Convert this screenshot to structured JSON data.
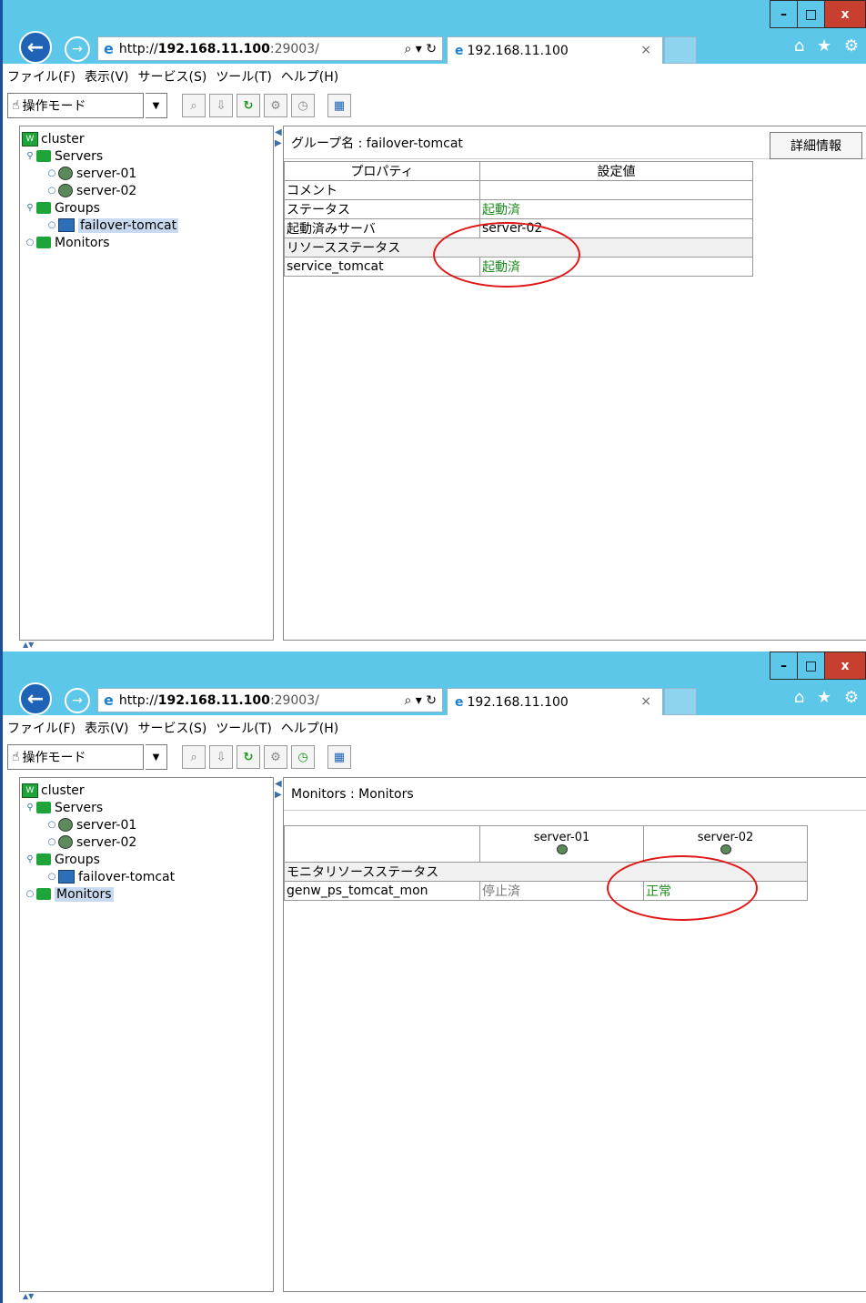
{
  "browser": {
    "url_host": "http://",
    "url_bold": "192.168.11.100",
    "url_rest": ":29003/",
    "address_tools": "⌕ ▾ ↻",
    "tab_title": "192.168.11.100",
    "tab_close": "×",
    "right_icons": "⌂ ★ ⚙",
    "win_min": "–",
    "win_max": "□",
    "win_close": "x"
  },
  "menu": [
    "ファイル(F)",
    "表示(V)",
    "サービス(S)",
    "ツール(T)",
    "ヘルプ(H)"
  ],
  "toolbar": {
    "mode_label": "操作モード",
    "mode_icon": "hand-icon"
  },
  "tree": {
    "cluster": "cluster",
    "servers": "Servers",
    "server1": "server-01",
    "server2": "server-02",
    "groups": "Groups",
    "group1": "failover-tomcat",
    "monitors": "Monitors"
  },
  "panel1": {
    "heading": "グループ名 : failover-tomcat",
    "detail_button": "詳細情報",
    "col_property": "プロパティ",
    "col_value": "設定値",
    "rows": [
      {
        "name": "コメント",
        "value": ""
      },
      {
        "name": "ステータス",
        "value": "起動済"
      },
      {
        "name": "起動済みサーバ",
        "value": "server-02"
      }
    ],
    "section": "リソースステータス",
    "resource_rows": [
      {
        "name": "service_tomcat",
        "value": "起動済"
      }
    ]
  },
  "panel2": {
    "heading": "Monitors : Monitors",
    "col_server1": "server-01",
    "col_server2": "server-02",
    "section": "モニタリソースステータス",
    "rows": [
      {
        "name": "genw_ps_tomcat_mon",
        "server1": "停止済",
        "server2": "正常"
      }
    ]
  },
  "colors": {
    "titlebar": "#5dc7e9",
    "status_ok": "#1c8c1c",
    "highlight_ellipse": "#e01515"
  }
}
